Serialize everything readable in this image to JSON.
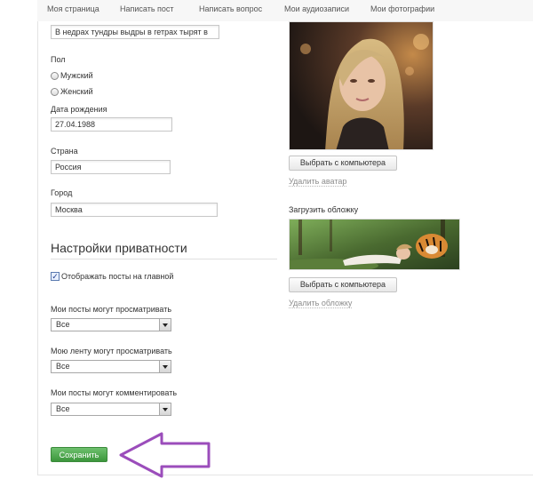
{
  "nav": {
    "items": [
      "Моя страница",
      "Написать пост",
      "Написать вопрос",
      "Мои аудиозаписи",
      "Мои фотографии"
    ]
  },
  "profile": {
    "status_value": "В недрах тундры выдры в гетрах тырят в",
    "gender_label": "Пол",
    "gender_options": [
      "Мужский",
      "Женский"
    ],
    "birthdate_label": "Дата рождения",
    "birthdate_value": "27.04.1988",
    "country_label": "Страна",
    "country_value": "Россия",
    "city_label": "Город",
    "city_value": "Москва"
  },
  "privacy": {
    "title": "Настройки приватности",
    "show_posts_label": "Отображать посты на главной",
    "show_posts_checked": true,
    "posts_view_label": "Мои посты могут просматривать",
    "posts_view_value": "Все",
    "feed_view_label": "Мою ленту могут просматривать",
    "feed_view_value": "Все",
    "posts_comment_label": "Мои посты могут комментировать",
    "posts_comment_value": "Все"
  },
  "save_label": "Сохранить",
  "avatar": {
    "upload_label": "Выбрать с компьютера",
    "delete_label": "Удалить аватар"
  },
  "cover": {
    "title": "Загрузить обложку",
    "upload_label": "Выбрать с компьютера",
    "delete_label": "Удалить обложку"
  },
  "colors": {
    "save_button": "#4caf50",
    "annotation_arrow": "#9b4dbb"
  }
}
